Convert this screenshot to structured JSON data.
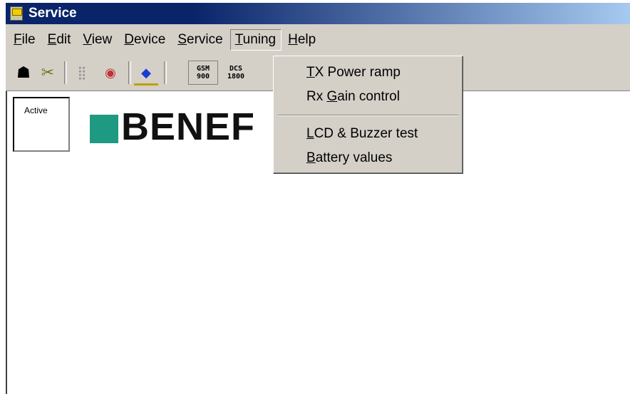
{
  "window": {
    "title": "Service",
    "icon": "app-icon"
  },
  "menubar": [
    {
      "label": "File",
      "mnemonic": "F",
      "rest": "ile"
    },
    {
      "label": "Edit",
      "mnemonic": "E",
      "rest": "dit"
    },
    {
      "label": "View",
      "mnemonic": "V",
      "rest": "iew"
    },
    {
      "label": "Device",
      "mnemonic": "D",
      "rest": "evice"
    },
    {
      "label": "Service",
      "mnemonic": "S",
      "rest": "ervice"
    },
    {
      "label": "Tuning",
      "mnemonic": "T",
      "rest": "uning"
    },
    {
      "label": "Help",
      "mnemonic": "H",
      "rest": "elp"
    }
  ],
  "toolbar": {
    "buttons": [
      {
        "icon": "phone-icon",
        "glyph": "☗"
      },
      {
        "icon": "satellite-icon",
        "glyph": "✂"
      },
      {
        "icon": "keypad-icon",
        "glyph": "⣿"
      },
      {
        "icon": "camera-icon",
        "glyph": "◉"
      },
      {
        "icon": "eraser-icon",
        "glyph": "◆"
      }
    ],
    "gsm_label_top": "GSM",
    "gsm_label_bottom": "900",
    "dcs_label_top": "DCS",
    "dcs_label_bottom": "1800"
  },
  "client": {
    "active_label": "Active",
    "logo_text": "BENEF",
    "logo_color": "#1f9a82"
  },
  "tuning_menu": {
    "items": [
      {
        "mnemonic": "T",
        "rest": "X Power ramp"
      },
      {
        "prefix": "Rx ",
        "mnemonic": "G",
        "rest": "ain control"
      },
      {
        "mnemonic": "L",
        "rest": "CD & Buzzer test"
      },
      {
        "mnemonic": "B",
        "rest": "attery values"
      }
    ]
  }
}
